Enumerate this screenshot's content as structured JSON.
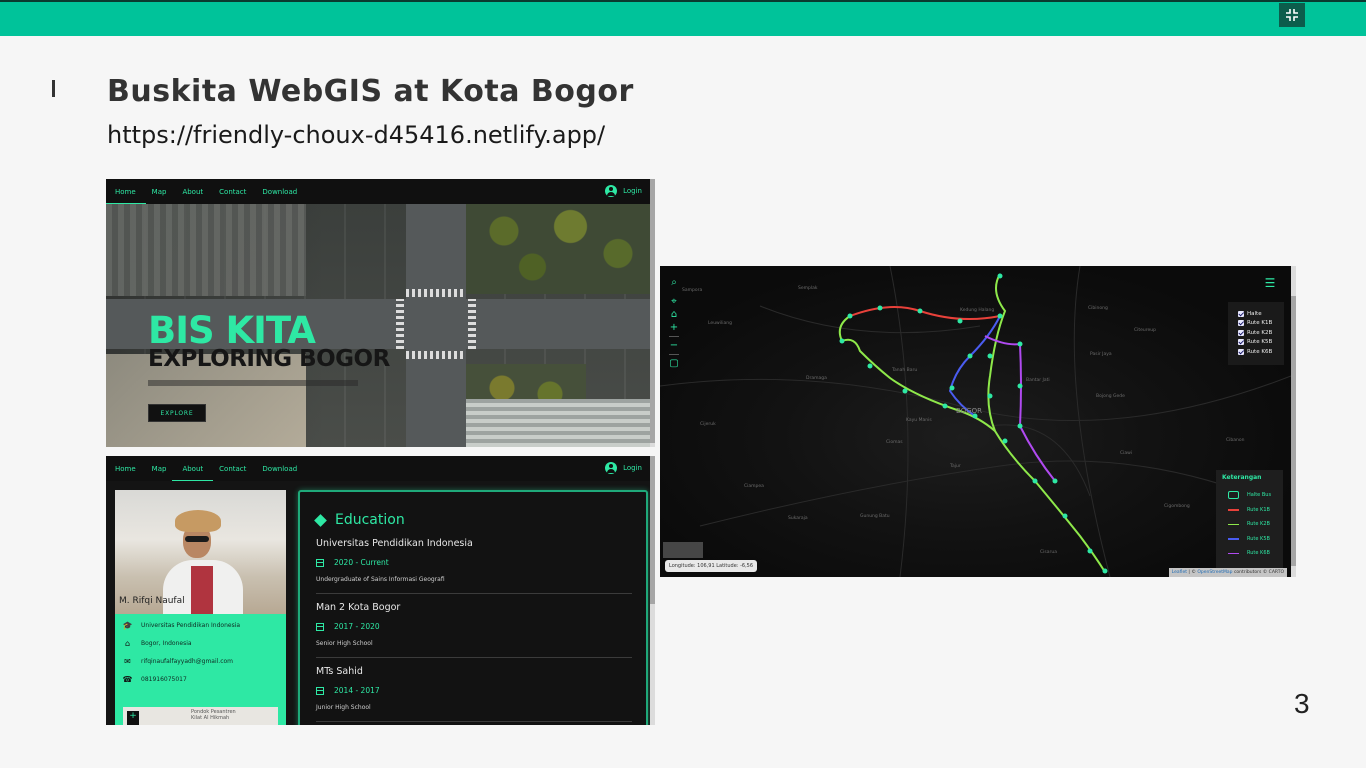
{
  "slide": {
    "title": "Buskita WebGIS at Kota Bogor",
    "url": "https://friendly-choux-d45416.netlify.app/",
    "page_number": "3",
    "accent_color": "#00c39a",
    "fullscreen_icon": "exit-fullscreen-icon"
  },
  "hero_shot": {
    "nav": [
      "Home",
      "Map",
      "About",
      "Contact",
      "Download"
    ],
    "active_tab": "Home",
    "login": "Login",
    "title1": "BIS KITA",
    "title2": "EXPLORING BOGOR",
    "explore": "EXPLORE"
  },
  "about_shot": {
    "nav": [
      "Home",
      "Map",
      "About",
      "Contact",
      "Download"
    ],
    "active_tab": "About",
    "login": "Login",
    "profile": {
      "name": "M. Rifqi Naufal",
      "university": "Universitas Pendidikan Indonesia",
      "location": "Bogor, Indonesia",
      "email": "rifqinaufalfayyadh@gmail.com",
      "phone": "081916075017",
      "map_poi": "Pondok Pesantren Kilat Al Hikmah"
    },
    "education": {
      "heading": "Education",
      "items": [
        {
          "school": "Universitas Pendidikan Indonesia",
          "year": "2020 - Current",
          "desc": "Undergraduate of Sains Informasi Geografi"
        },
        {
          "school": "Man 2 Kota Bogor",
          "year": "2017 - 2020",
          "desc": "Senior High School"
        },
        {
          "school": "MTs Sahid",
          "year": "2014 - 2017",
          "desc": "Junior High School"
        }
      ]
    }
  },
  "map_shot": {
    "layers": [
      "Halte",
      "Rute K1B",
      "Rute K2B",
      "Rute K5B",
      "Rute K6B"
    ],
    "legend": {
      "title": "Keterangan",
      "items": [
        {
          "label": "Halte Bus",
          "color": "#2ee8a4"
        },
        {
          "label": "Rute K1B",
          "color": "#e8413a"
        },
        {
          "label": "Rute K2B",
          "color": "#8ee84a"
        },
        {
          "label": "Rute K5B",
          "color": "#4a5cf0"
        },
        {
          "label": "Rute K6B",
          "color": "#b04af0"
        }
      ]
    },
    "coords": "Longitude: 106,91 Latitude: -6,56",
    "attribution_leaflet": "Leaflet",
    "attribution_osm": "OpenStreetMap",
    "attribution_rest": "contributors © CARTO",
    "city_label": "BOGOR",
    "place_labels": [
      "Sampora",
      "Semplak",
      "Kedung Halang",
      "Cibinong",
      "Citeureup",
      "Bantar Jati",
      "Ciawi",
      "Cigombong",
      "Ciomas",
      "Dramaga",
      "Ciampea",
      "Leuwiliang",
      "Cijeruk",
      "Tanah Baru",
      "Kayu Manis",
      "Tajur",
      "Cisarua",
      "Sukaraja",
      "Bojong Gede",
      "Pasir Jaya",
      "Gunung Batu",
      "Cibanon"
    ]
  }
}
